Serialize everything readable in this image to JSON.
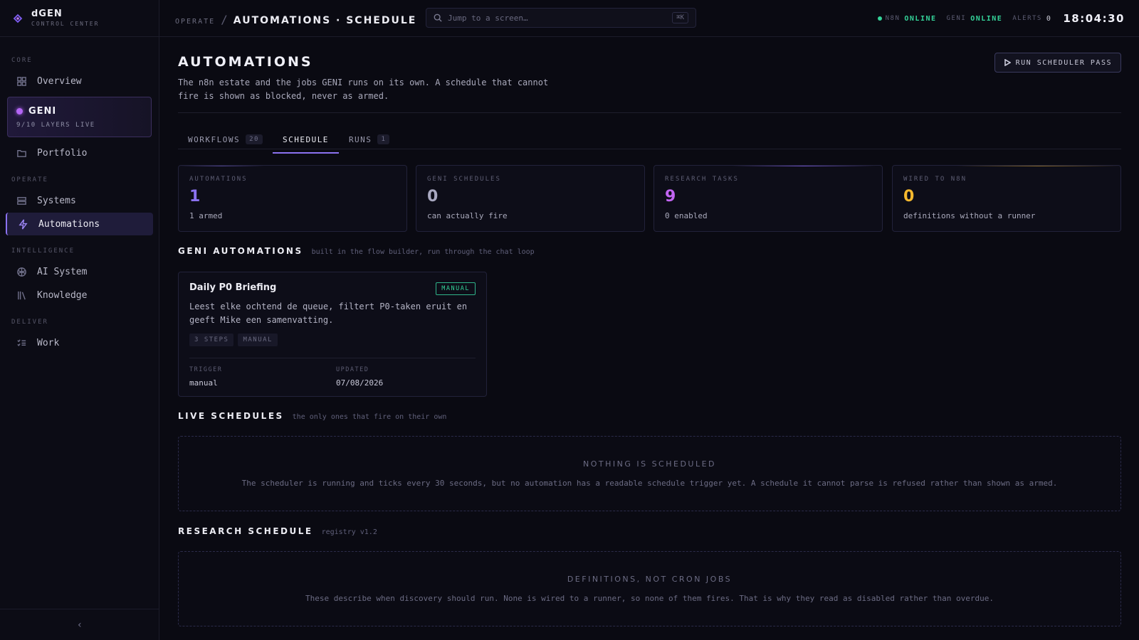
{
  "brand": {
    "name": "dGEN",
    "subtitle": "CONTROL CENTER"
  },
  "sidebar": {
    "sections": [
      "CORE",
      "OPERATE",
      "INTELLIGENCE",
      "DELIVER"
    ],
    "items": [
      {
        "label": "Overview",
        "icon": "grid-icon"
      },
      {
        "label": "Portfolio",
        "icon": "folder-icon"
      },
      {
        "label": "Systems",
        "icon": "server-icon"
      },
      {
        "label": "Automations",
        "icon": "bolt-icon",
        "active": true
      },
      {
        "label": "AI System",
        "icon": "brain-icon"
      },
      {
        "label": "Knowledge",
        "icon": "library-icon"
      },
      {
        "label": "Work",
        "icon": "checklist-icon"
      }
    ],
    "geni": {
      "label": "GENI",
      "status": "9/10 LAYERS LIVE"
    },
    "collapse_glyph": "‹"
  },
  "topbar": {
    "breadcrumb_parent": "OPERATE",
    "breadcrumb_sep": "/",
    "title": "AUTOMATIONS · SCHEDULE",
    "search_placeholder": "Jump to a screen…",
    "search_shortcut": "⌘K",
    "n8n_label": "N8N",
    "n8n_status": "ONLINE",
    "geni_label": "GENI",
    "geni_status": "ONLINE",
    "alerts_label": "ALERTS",
    "alerts_count": "0",
    "clock": "18:04:30"
  },
  "page": {
    "title": "AUTOMATIONS",
    "description": "The n8n estate and the jobs GENI runs on its own. A schedule that cannot fire is shown as blocked, never as armed.",
    "run_button": "RUN SCHEDULER PASS"
  },
  "tabs": [
    {
      "label": "WORKFLOWS",
      "count": "20"
    },
    {
      "label": "SCHEDULE",
      "count": ""
    },
    {
      "label": "RUNS",
      "count": "1"
    }
  ],
  "stats": [
    {
      "label": "AUTOMATIONS",
      "value": "1",
      "sub": "1 armed",
      "color": "#8b72f0"
    },
    {
      "label": "GENI SCHEDULES",
      "value": "0",
      "sub": "can actually fire",
      "color": "#a8a8c0"
    },
    {
      "label": "RESEARCH TASKS",
      "value": "9",
      "sub": "0 enabled",
      "color": "#c265f2"
    },
    {
      "label": "WIRED TO N8N",
      "value": "0",
      "sub": "definitions without a runner",
      "color": "#f5b82e"
    }
  ],
  "geni_automations": {
    "title": "GENI AUTOMATIONS",
    "subtitle": "built in the flow builder, run through the chat loop",
    "card": {
      "title": "Daily P0 Briefing",
      "badge": "MANUAL",
      "description": "Leest elke ochtend de queue, filtert P0-taken eruit en geeft Mike een samenvatting.",
      "chips": [
        "3 STEPS",
        "MANUAL"
      ],
      "trigger_label": "TRIGGER",
      "trigger_value": "manual",
      "updated_label": "UPDATED",
      "updated_value": "07/08/2026"
    }
  },
  "live_schedules": {
    "title": "LIVE SCHEDULES",
    "subtitle": "the only ones that fire on their own",
    "empty_title": "NOTHING IS SCHEDULED",
    "empty_desc": "The scheduler is running and ticks every 30 seconds, but no automation has a readable schedule trigger yet. A schedule it cannot parse is refused rather than shown as armed."
  },
  "research_schedule": {
    "title": "RESEARCH SCHEDULE",
    "subtitle": "registry v1.2",
    "empty_title": "DEFINITIONS, NOT CRON JOBS",
    "empty_desc": "These describe when discovery should run. None is wired to a runner, so none of them fires. That is why they read as disabled rather than overdue."
  }
}
